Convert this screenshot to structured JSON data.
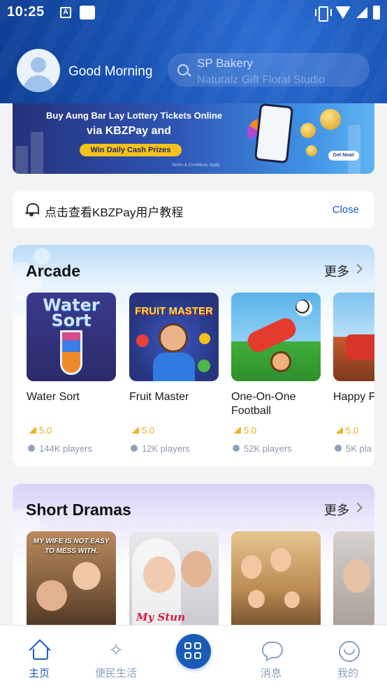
{
  "status_bar": {
    "time": "10:25",
    "app_badge": "A"
  },
  "header": {
    "greeting": "Good Morning",
    "search_lines": [
      "SP Bakery",
      "Naturalz Gift Floral Studio"
    ]
  },
  "banner": {
    "line1": "Buy Aung Bar Lay Lottery Tickets Online",
    "line2": "via KBZPay and",
    "pill": "Win Daily Cash Prizes",
    "cta": "Get Now!",
    "note": "Terms & Conditions Apply"
  },
  "notice": {
    "text": "点击查看KBZPay用户教程",
    "close_label": "Close"
  },
  "arcade": {
    "title": "Arcade",
    "more": "更多",
    "thumb_texts": {
      "water": [
        "Water",
        "Sort"
      ],
      "fruit": "FRUIT MASTER"
    },
    "games": [
      {
        "name": "Water Sort",
        "rating": "5.0",
        "players": "144K players"
      },
      {
        "name": "Fruit Master",
        "rating": "5.0",
        "players": "12K players"
      },
      {
        "name": "One-On-One Football",
        "name_line1": "One-On-One",
        "name_line2": "Football",
        "rating": "5.0",
        "players": "52K players"
      },
      {
        "name": "Happy F",
        "rating": "5.0",
        "players": "5K pla"
      }
    ]
  },
  "short_dramas": {
    "title": "Short Dramas",
    "more": "更多",
    "poster_texts": {
      "d1_line1": "MY WIFE IS NOT EASY",
      "d1_line2": "TO MESS WITH.",
      "d2": "My Stun"
    }
  },
  "bottom_nav": {
    "items": [
      {
        "label": "主页",
        "icon": "home-icon",
        "active": true
      },
      {
        "label": "便民生活",
        "icon": "sparkle-icon",
        "active": false
      },
      {
        "label": "",
        "icon": "grid-apps-icon",
        "active": false
      },
      {
        "label": "消息",
        "icon": "chat-bubble-icon",
        "active": false
      },
      {
        "label": "我的",
        "icon": "smiley-face-icon",
        "active": false
      }
    ]
  },
  "colors": {
    "primary": "#1a5bb8",
    "header": "#1a55b8",
    "rating": "#e9a81a"
  }
}
